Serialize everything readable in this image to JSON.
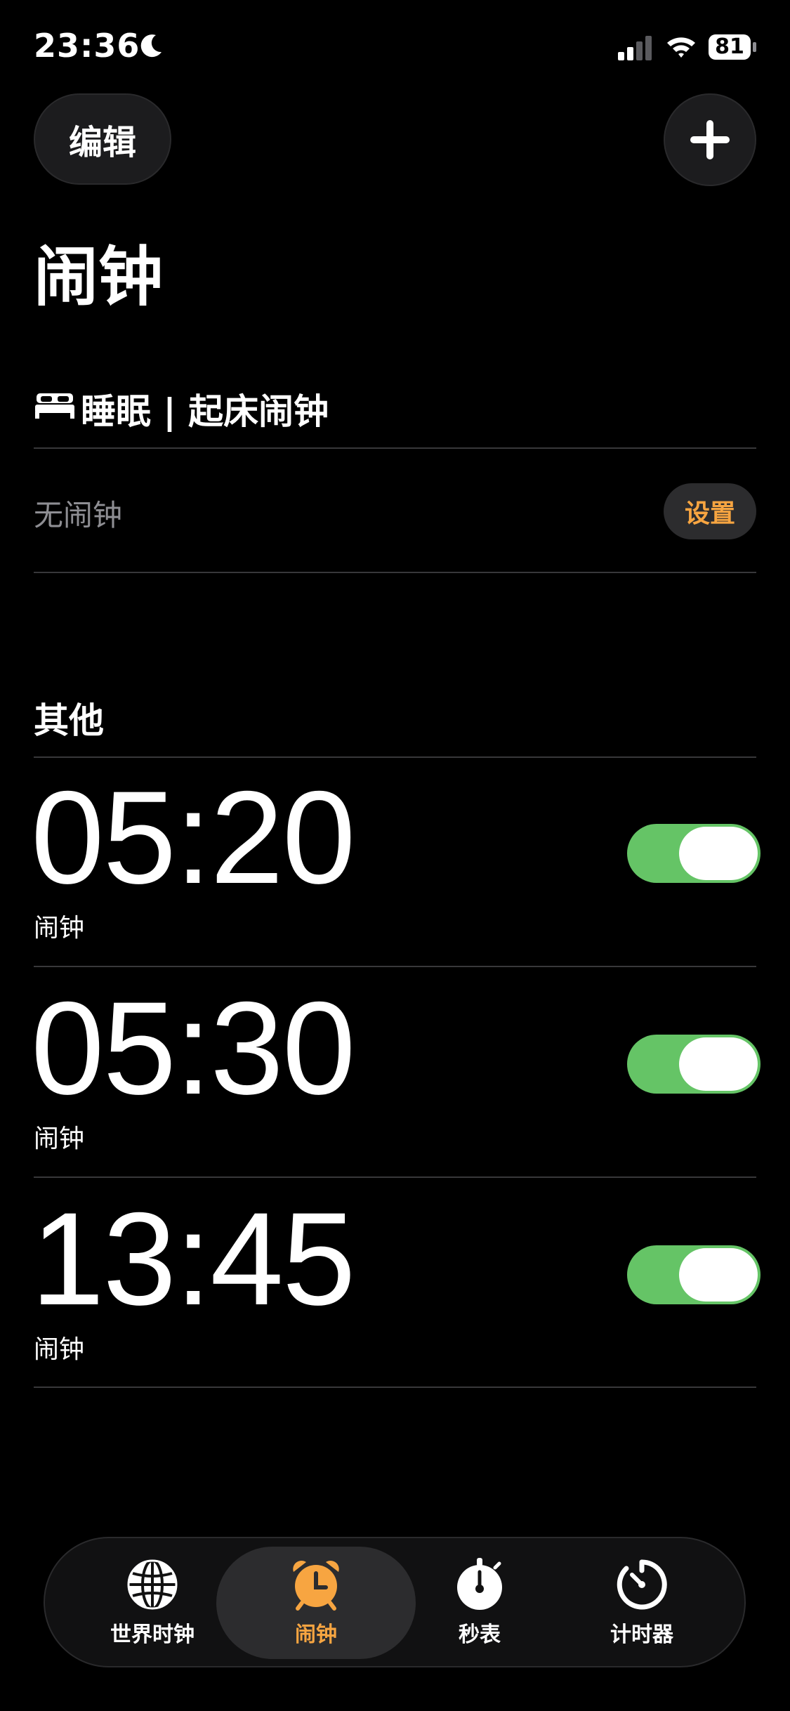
{
  "status_bar": {
    "time": "23:36",
    "battery": "81"
  },
  "header": {
    "edit_label": "编辑",
    "title": "闹钟"
  },
  "sleep_section": {
    "title": "睡眠 | 起床闹钟",
    "empty_text": "无闹钟",
    "setup_label": "设置"
  },
  "other_section": {
    "title": "其他"
  },
  "alarms": [
    {
      "time": "05:20",
      "label": "闹钟",
      "enabled": true
    },
    {
      "time": "05:30",
      "label": "闹钟",
      "enabled": true
    },
    {
      "time": "13:45",
      "label": "闹钟",
      "enabled": true
    }
  ],
  "tabs": [
    {
      "label": "世界时钟",
      "icon": "globe-icon",
      "active": false
    },
    {
      "label": "闹钟",
      "icon": "alarm-clock-icon",
      "active": true
    },
    {
      "label": "秒表",
      "icon": "stopwatch-icon",
      "active": false
    },
    {
      "label": "计时器",
      "icon": "timer-icon",
      "active": false
    }
  ],
  "colors": {
    "accent": "#f7a541",
    "toggle_on": "#65c466",
    "background": "#000000"
  }
}
